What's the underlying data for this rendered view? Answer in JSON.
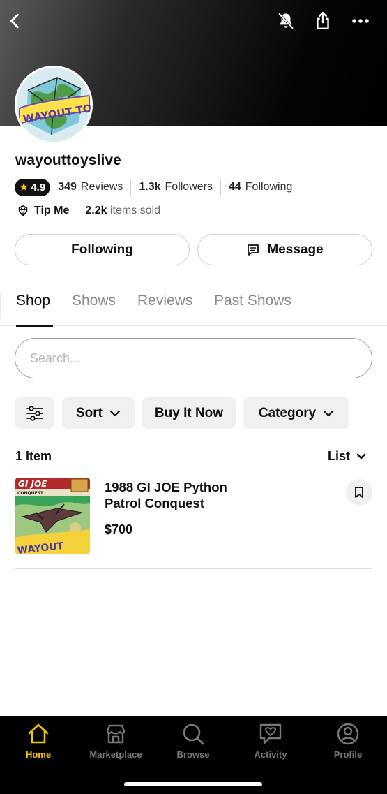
{
  "profile": {
    "username": "wayouttoyslive",
    "avatar_text": "WAYOUT TO",
    "rating": "4.9",
    "reviews_count": "349",
    "reviews_label": "Reviews",
    "followers_count": "1.3k",
    "followers_label": "Followers",
    "following_count": "44",
    "following_label": "Following",
    "tip_label": "Tip Me",
    "items_sold_count": "2.2k",
    "items_sold_label": "items sold"
  },
  "actions": {
    "following_button": "Following",
    "message_button": "Message"
  },
  "tabs": [
    {
      "label": "Shop",
      "active": true
    },
    {
      "label": "Shows",
      "active": false
    },
    {
      "label": "Reviews",
      "active": false
    },
    {
      "label": "Past Shows",
      "active": false
    }
  ],
  "search": {
    "placeholder": "Search..."
  },
  "filters": {
    "sort_label": "Sort",
    "buy_now_label": "Buy It Now",
    "category_label": "Category"
  },
  "results": {
    "count_label": "1 Item",
    "view_label": "List"
  },
  "items": [
    {
      "title": "1988 GI JOE Python Patrol Conquest",
      "price": "$700",
      "thumb_brand": "GI JOE",
      "thumb_subtitle": "CONQUEST",
      "thumb_sticker": "WAYOUT"
    }
  ],
  "nav": [
    {
      "label": "Home",
      "icon": "home-icon",
      "active": true
    },
    {
      "label": "Marketplace",
      "icon": "marketplace-icon",
      "active": false
    },
    {
      "label": "Browse",
      "icon": "search-icon",
      "active": false
    },
    {
      "label": "Activity",
      "icon": "activity-icon",
      "active": false
    },
    {
      "label": "Profile",
      "icon": "profile-icon",
      "active": false
    }
  ],
  "colors": {
    "accent": "#f7c600",
    "rating_star": "#f5c518",
    "nav_bg": "#000000",
    "chip_bg": "#f0f0f0"
  }
}
